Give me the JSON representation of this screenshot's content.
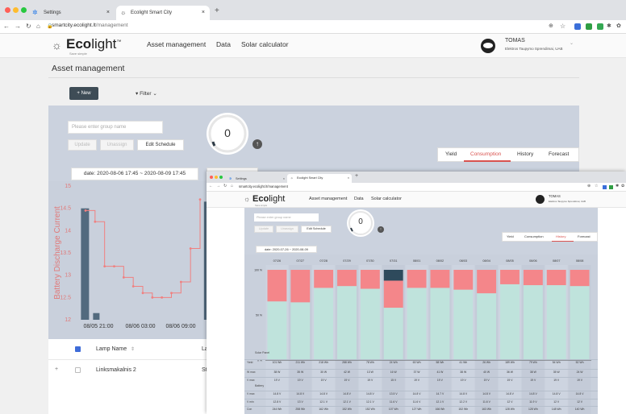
{
  "back": {
    "tabs": [
      {
        "label": "Settings",
        "close": "×"
      },
      {
        "label": "Ecolight Smart City",
        "close": "×"
      }
    ],
    "new_tab": "+",
    "url_host": "smartcity.ecolight.lt",
    "url_path": "/management",
    "logo_bold": "Eco",
    "logo_light": "light",
    "logo_tm": "™",
    "logo_sub": "Save simple",
    "nav": [
      "Asset management",
      "Data",
      "Solar calculator"
    ],
    "user_name": "TOMAS",
    "user_org": "Elektros Taupymo Sprendimai, UAB",
    "page_title": "Asset management",
    "new_button": "+ New",
    "filter_button": "Filter",
    "group_placeholder": "Please enter group name",
    "update_button": "Update",
    "unassign_button": "Unassign",
    "edit_schedule_button": "Edit Schedule",
    "gauge_value": "0",
    "tabs_right": [
      "Yield",
      "Consumption",
      "History",
      "Forecast"
    ],
    "date_label": "date: 2020-08-06 17:45 ~ 2020-08-09 17:45",
    "table_header": [
      "Lamp Name",
      "La"
    ],
    "table_row": {
      "expand": "+",
      "name": "Linksmakalnis 2",
      "col2": "St"
    },
    "sort_icon": "⇕",
    "accent": "#d9534f"
  },
  "chart_data": [
    {
      "type": "line",
      "ylabel": "Battery Discharge Current",
      "ylim": [
        12,
        15
      ],
      "yticks": [
        "15",
        "14.5",
        "14",
        "13.5",
        "13",
        "12.5",
        "12"
      ],
      "xticks": [
        "08/05 21:00",
        "08/06 03:00",
        "08/06 09:00"
      ],
      "series": [
        {
          "values": [
            14.45,
            14.2,
            13.2,
            13.2,
            12.95,
            12.75,
            12.6,
            12.5,
            12.5,
            12.6,
            12.85,
            13.6,
            14.7
          ]
        }
      ],
      "bars_x": [
        0.015,
        0.11,
        0.98
      ],
      "bars": [
        14.5,
        12.15,
        14.65
      ]
    },
    {
      "type": "bar",
      "categories": [
        "07/26",
        "07/27",
        "07/28",
        "07/29",
        "07/30",
        "07/31",
        "08/01",
        "08/02",
        "08/03",
        "08/04",
        "08/05",
        "08/06",
        "08/07",
        "08/08"
      ],
      "ytick_labels": [
        "100 %",
        "50 %",
        "0 %"
      ],
      "ylim": [
        0,
        100
      ],
      "series": [
        {
          "values": [
            65,
            64,
            80,
            82,
            79,
            58,
            80,
            80,
            78,
            74,
            84,
            83,
            83,
            82
          ]
        },
        {
          "values": [
            35,
            36,
            20,
            18,
            21,
            30,
            20,
            20,
            22,
            26,
            16,
            17,
            17,
            18
          ]
        },
        {
          "values": [
            0,
            0,
            0,
            0,
            0,
            12,
            0,
            0,
            0,
            0,
            0,
            0,
            0,
            0
          ]
        }
      ],
      "colors": [
        "#bfe3dc",
        "#f4868a",
        "#2e4a5c"
      ]
    }
  ],
  "front": {
    "tabs": [
      {
        "label": "Settings",
        "close": "×"
      },
      {
        "label": "Ecolight Smart City",
        "close": "×"
      }
    ],
    "new_tab": "+",
    "url": "smartcity.ecolight.lt/management",
    "logo_bold": "Eco",
    "logo_light": "light",
    "logo_sub": "Save simple",
    "nav": [
      "Asset management",
      "Data",
      "Solar calculator"
    ],
    "user_name": "TOMAS",
    "user_org": "Elektros Taupymo Sprendimai, UAB",
    "group_placeholder": "Please enter group name",
    "update_button": "Update",
    "unassign_button": "Unassign",
    "edit_schedule_button": "Edit Schedule",
    "gauge_value": "0",
    "tabs_right": [
      "Yield",
      "Consumption",
      "History",
      "Forecast"
    ],
    "date_label": "date: 2020-07-26 ~ 2020-08-09",
    "solar_panel": "Solar Panel",
    "battery": "Battery",
    "row_labels": [
      "Yield",
      "W max",
      "V max",
      "",
      "V max",
      "V min",
      "Con"
    ],
    "rows": [
      [
        "101 Wh",
        "211 Wh",
        "218 Wh",
        "288 Wh",
        "78 Wh",
        "24 Wh",
        "63 Wh",
        "58 Wh",
        "41 Wh",
        "26 Wh",
        "189 Wh",
        "79 Wh",
        "54 Wh",
        "52 Wh"
      ],
      [
        "38 W",
        "35 W",
        "30 W",
        "42 W",
        "13 W",
        "16 W",
        "37 W",
        "41 W",
        "38 W",
        "40 W",
        "36 W",
        "38 W",
        "35 W",
        "24 W"
      ],
      [
        "19 V",
        "19 V",
        "19 V",
        "19 V",
        "19 V",
        "15 V",
        "19 V",
        "19 V",
        "19 V",
        "19 V",
        "19 V",
        "19 V",
        "19 V",
        "19 V"
      ],
      [
        "14.8 V",
        "14.8 V",
        "14.8 V",
        "14.8 V",
        "14.8 V",
        "13.5 V",
        "14.8 V",
        "14.7 V",
        "14.8 V",
        "14.8 V",
        "14.8 V",
        "14.8 V",
        "14.8 V",
        "14.8 V"
      ],
      [
        "12.8 V",
        "13 V",
        "12.1 V",
        "12.1 V",
        "12.1 V",
        "11.6 V",
        "11.6 V",
        "12.1 V",
        "12.2 V",
        "11.6 V",
        "12 V",
        "11.9 V",
        "12 V",
        "12 V"
      ],
      [
        "244 Wh",
        "258 Wh",
        "162 Wh",
        "152 Wh",
        "152 Wh",
        "107 Wh",
        "127 Wh",
        "166 Wh",
        "152 Wh",
        "163 Wh",
        "128 Wh",
        "128 Wh",
        "148 Wh",
        "140 Wh"
      ]
    ]
  }
}
